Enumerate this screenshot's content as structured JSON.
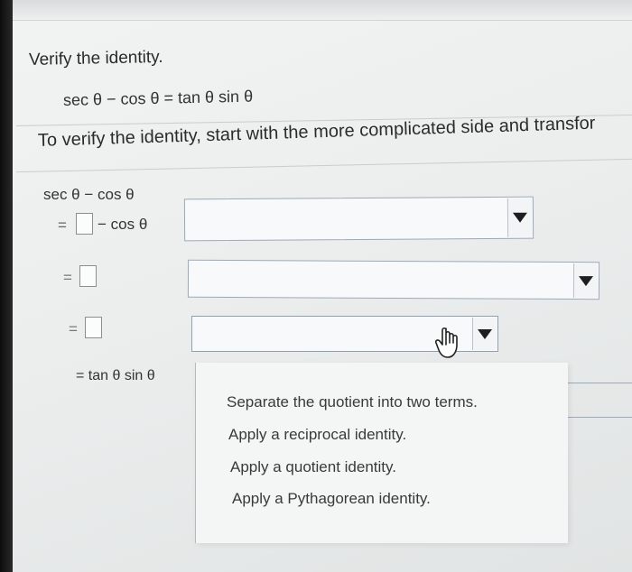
{
  "question": {
    "title": "Verify the identity.",
    "identity": "sec θ − cos θ = tan θ sin θ"
  },
  "instruction": "To verify the identity, start with the more complicated side and transfor",
  "steps": {
    "start": "sec θ − cos θ",
    "row1_prefix": "=",
    "row1_suffix": "− cos θ",
    "row2_prefix": "=",
    "row3_prefix": "=",
    "result": "= tan θ sin θ"
  },
  "dropdown": {
    "options": [
      "Separate the quotient into two terms.",
      "Apply a reciprocal identity.",
      "Apply a quotient identity.",
      "Apply a Pythagorean identity."
    ]
  },
  "colors": {
    "screen": "#eceeee",
    "text": "#2b2b2b",
    "select_border": "#9aa8b8"
  }
}
